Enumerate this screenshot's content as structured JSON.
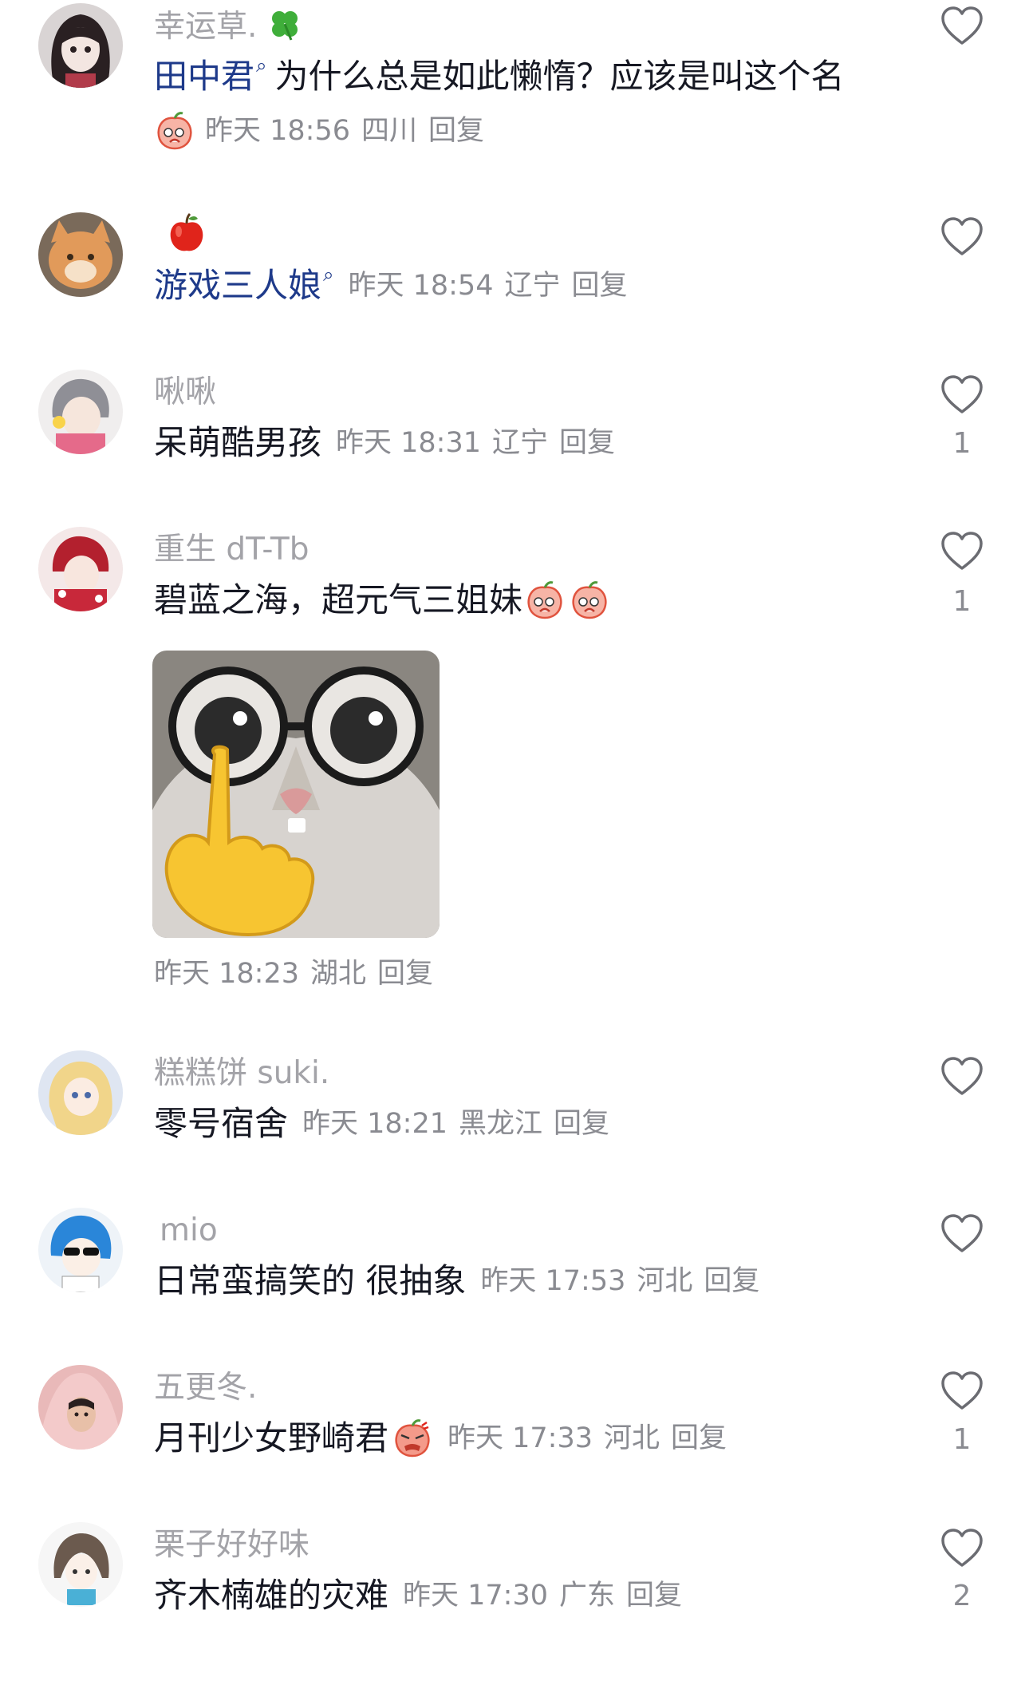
{
  "comments": [
    {
      "username": "幸运草.",
      "text": "为什么总是如此懒惰？应该是叫这个名",
      "mention": "田中君",
      "time": "昨天 18:56",
      "location": "四川",
      "reply": "回复",
      "likes": ""
    },
    {
      "username": "",
      "mention": "游戏三人娘",
      "time": "昨天 18:54",
      "location": "辽宁",
      "reply": "回复",
      "likes": ""
    },
    {
      "username": "啾啾",
      "text": "呆萌酷男孩",
      "time": "昨天 18:31",
      "location": "辽宁",
      "reply": "回复",
      "likes": "1"
    },
    {
      "username": "重生 dT-Tb",
      "text": "碧蓝之海，超元气三姐妹",
      "time": "昨天 18:23",
      "location": "湖北",
      "reply": "回复",
      "likes": "1"
    },
    {
      "username": "糕糕饼 suki.",
      "text": "零号宿舍",
      "time": "昨天 18:21",
      "location": "黑龙江",
      "reply": "回复",
      "likes": ""
    },
    {
      "username": "mio",
      "text": "日常蛮搞笑的 很抽象",
      "time": "昨天 17:53",
      "location": "河北",
      "reply": "回复",
      "likes": ""
    },
    {
      "username": "五更冬.",
      "text": "月刊少女野崎君",
      "time": "昨天 17:33",
      "location": "河北",
      "reply": "回复",
      "likes": "1"
    },
    {
      "username": "栗子好好味",
      "text": "齐木楠雄的灾难",
      "time": "昨天 17:30",
      "location": "广东",
      "reply": "回复",
      "likes": "2"
    }
  ],
  "icons": {
    "like": "heart-outline-icon",
    "clover": "four-leaf-clover-icon",
    "apple": "red-apple-icon",
    "peach": "peach-face-emoji",
    "angry_peach": "angry-peach-emoji",
    "search_mini": "search-icon"
  },
  "colors": {
    "username": "#a3a3a8",
    "text": "#161823",
    "meta": "#8a8b91",
    "mention": "#1e3a8a"
  }
}
